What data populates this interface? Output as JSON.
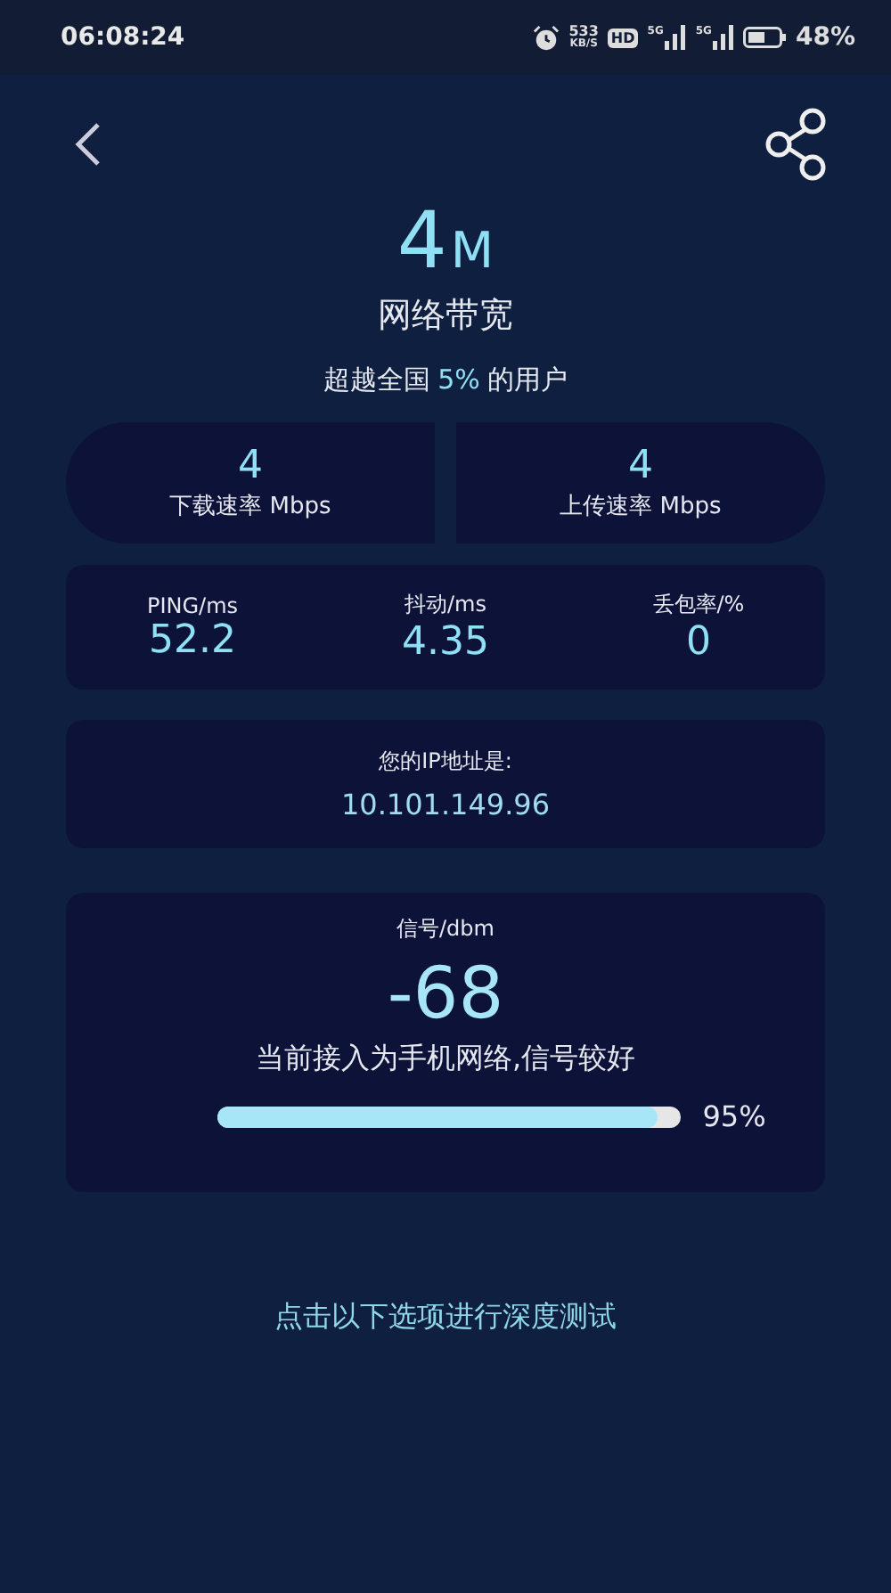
{
  "status_bar": {
    "time": "06:08:24",
    "net_speed": "533",
    "net_unit": "KB/S",
    "hd": "HD",
    "sims": [
      {
        "network": "5G"
      },
      {
        "network": "5G"
      }
    ],
    "battery": "48%"
  },
  "bandwidth": {
    "value": "4",
    "unit": "M",
    "label": "网络带宽"
  },
  "rank": {
    "before": "超越全国",
    "highlight": "5%",
    "after": "的用户"
  },
  "speeds": [
    {
      "value": "4",
      "label": "下载速率 Mbps"
    },
    {
      "value": "4",
      "label": "上传速率 Mbps"
    }
  ],
  "metrics": [
    {
      "label": "PING/ms",
      "value": "52.2"
    },
    {
      "label": "抖动/ms",
      "value": "4.35"
    },
    {
      "label": "丢包率/%",
      "value": "0"
    }
  ],
  "ip": {
    "label": "您的IP地址是:",
    "value": "10.101.149.96"
  },
  "signal": {
    "label": "信号/dbm",
    "value": "-68",
    "description": "当前接入为手机网络,信号较好",
    "level": 0.95,
    "reading": "95%"
  },
  "deep_test_link": "点击以下选项进行深度测试"
}
